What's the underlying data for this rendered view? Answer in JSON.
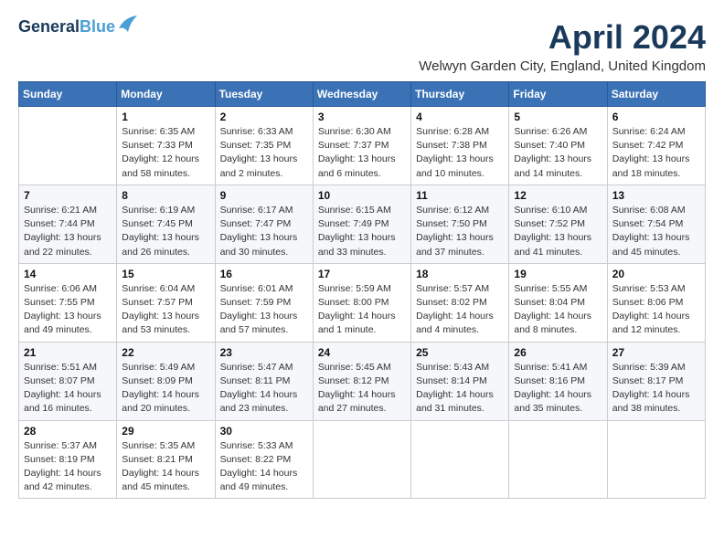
{
  "header": {
    "logo_line1": "General",
    "logo_line2": "Blue",
    "month_title": "April 2024",
    "location": "Welwyn Garden City, England, United Kingdom"
  },
  "days_of_week": [
    "Sunday",
    "Monday",
    "Tuesday",
    "Wednesday",
    "Thursday",
    "Friday",
    "Saturday"
  ],
  "weeks": [
    [
      {
        "day": "",
        "info": ""
      },
      {
        "day": "1",
        "info": "Sunrise: 6:35 AM\nSunset: 7:33 PM\nDaylight: 12 hours\nand 58 minutes."
      },
      {
        "day": "2",
        "info": "Sunrise: 6:33 AM\nSunset: 7:35 PM\nDaylight: 13 hours\nand 2 minutes."
      },
      {
        "day": "3",
        "info": "Sunrise: 6:30 AM\nSunset: 7:37 PM\nDaylight: 13 hours\nand 6 minutes."
      },
      {
        "day": "4",
        "info": "Sunrise: 6:28 AM\nSunset: 7:38 PM\nDaylight: 13 hours\nand 10 minutes."
      },
      {
        "day": "5",
        "info": "Sunrise: 6:26 AM\nSunset: 7:40 PM\nDaylight: 13 hours\nand 14 minutes."
      },
      {
        "day": "6",
        "info": "Sunrise: 6:24 AM\nSunset: 7:42 PM\nDaylight: 13 hours\nand 18 minutes."
      }
    ],
    [
      {
        "day": "7",
        "info": "Sunrise: 6:21 AM\nSunset: 7:44 PM\nDaylight: 13 hours\nand 22 minutes."
      },
      {
        "day": "8",
        "info": "Sunrise: 6:19 AM\nSunset: 7:45 PM\nDaylight: 13 hours\nand 26 minutes."
      },
      {
        "day": "9",
        "info": "Sunrise: 6:17 AM\nSunset: 7:47 PM\nDaylight: 13 hours\nand 30 minutes."
      },
      {
        "day": "10",
        "info": "Sunrise: 6:15 AM\nSunset: 7:49 PM\nDaylight: 13 hours\nand 33 minutes."
      },
      {
        "day": "11",
        "info": "Sunrise: 6:12 AM\nSunset: 7:50 PM\nDaylight: 13 hours\nand 37 minutes."
      },
      {
        "day": "12",
        "info": "Sunrise: 6:10 AM\nSunset: 7:52 PM\nDaylight: 13 hours\nand 41 minutes."
      },
      {
        "day": "13",
        "info": "Sunrise: 6:08 AM\nSunset: 7:54 PM\nDaylight: 13 hours\nand 45 minutes."
      }
    ],
    [
      {
        "day": "14",
        "info": "Sunrise: 6:06 AM\nSunset: 7:55 PM\nDaylight: 13 hours\nand 49 minutes."
      },
      {
        "day": "15",
        "info": "Sunrise: 6:04 AM\nSunset: 7:57 PM\nDaylight: 13 hours\nand 53 minutes."
      },
      {
        "day": "16",
        "info": "Sunrise: 6:01 AM\nSunset: 7:59 PM\nDaylight: 13 hours\nand 57 minutes."
      },
      {
        "day": "17",
        "info": "Sunrise: 5:59 AM\nSunset: 8:00 PM\nDaylight: 14 hours\nand 1 minute."
      },
      {
        "day": "18",
        "info": "Sunrise: 5:57 AM\nSunset: 8:02 PM\nDaylight: 14 hours\nand 4 minutes."
      },
      {
        "day": "19",
        "info": "Sunrise: 5:55 AM\nSunset: 8:04 PM\nDaylight: 14 hours\nand 8 minutes."
      },
      {
        "day": "20",
        "info": "Sunrise: 5:53 AM\nSunset: 8:06 PM\nDaylight: 14 hours\nand 12 minutes."
      }
    ],
    [
      {
        "day": "21",
        "info": "Sunrise: 5:51 AM\nSunset: 8:07 PM\nDaylight: 14 hours\nand 16 minutes."
      },
      {
        "day": "22",
        "info": "Sunrise: 5:49 AM\nSunset: 8:09 PM\nDaylight: 14 hours\nand 20 minutes."
      },
      {
        "day": "23",
        "info": "Sunrise: 5:47 AM\nSunset: 8:11 PM\nDaylight: 14 hours\nand 23 minutes."
      },
      {
        "day": "24",
        "info": "Sunrise: 5:45 AM\nSunset: 8:12 PM\nDaylight: 14 hours\nand 27 minutes."
      },
      {
        "day": "25",
        "info": "Sunrise: 5:43 AM\nSunset: 8:14 PM\nDaylight: 14 hours\nand 31 minutes."
      },
      {
        "day": "26",
        "info": "Sunrise: 5:41 AM\nSunset: 8:16 PM\nDaylight: 14 hours\nand 35 minutes."
      },
      {
        "day": "27",
        "info": "Sunrise: 5:39 AM\nSunset: 8:17 PM\nDaylight: 14 hours\nand 38 minutes."
      }
    ],
    [
      {
        "day": "28",
        "info": "Sunrise: 5:37 AM\nSunset: 8:19 PM\nDaylight: 14 hours\nand 42 minutes."
      },
      {
        "day": "29",
        "info": "Sunrise: 5:35 AM\nSunset: 8:21 PM\nDaylight: 14 hours\nand 45 minutes."
      },
      {
        "day": "30",
        "info": "Sunrise: 5:33 AM\nSunset: 8:22 PM\nDaylight: 14 hours\nand 49 minutes."
      },
      {
        "day": "",
        "info": ""
      },
      {
        "day": "",
        "info": ""
      },
      {
        "day": "",
        "info": ""
      },
      {
        "day": "",
        "info": ""
      }
    ]
  ]
}
